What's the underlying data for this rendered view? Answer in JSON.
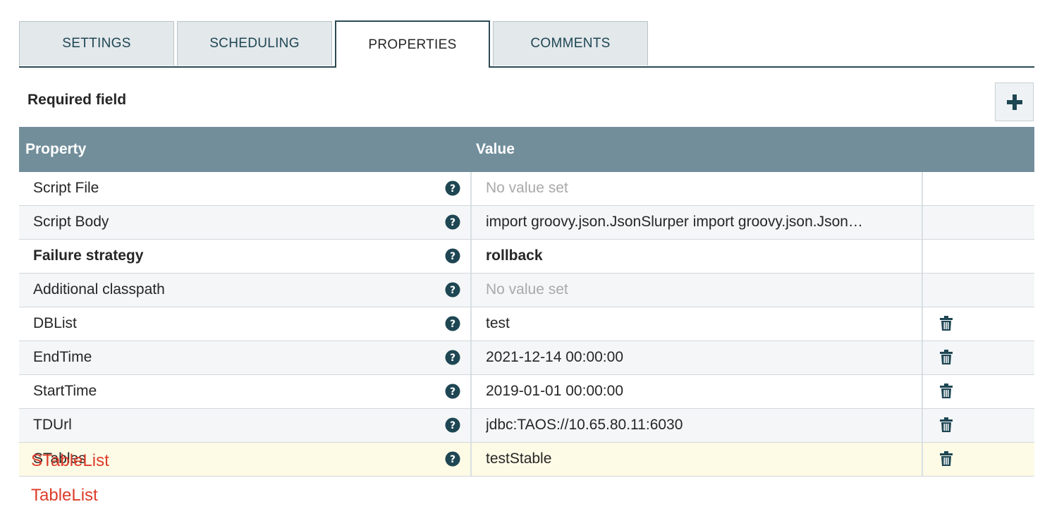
{
  "tabs": [
    {
      "label": "SETTINGS",
      "active": false
    },
    {
      "label": "SCHEDULING",
      "active": false
    },
    {
      "label": "PROPERTIES",
      "active": true
    },
    {
      "label": "COMMENTS",
      "active": false
    }
  ],
  "required_label": "Required field",
  "add_button_icon": "plus-icon",
  "table": {
    "headers": {
      "property": "Property",
      "value": "Value"
    },
    "rows": [
      {
        "name": "Script File",
        "value": "No value set",
        "empty": true,
        "bold": false,
        "deletable": false
      },
      {
        "name": "Script Body",
        "value": "import groovy.json.JsonSlurper import groovy.json.Json…",
        "empty": false,
        "bold": false,
        "deletable": false
      },
      {
        "name": "Failure strategy",
        "value": "rollback",
        "empty": false,
        "bold": true,
        "deletable": false
      },
      {
        "name": "Additional classpath",
        "value": "No value set",
        "empty": true,
        "bold": false,
        "deletable": false
      },
      {
        "name": "DBList",
        "value": "test",
        "empty": false,
        "bold": false,
        "deletable": true
      },
      {
        "name": "EndTime",
        "value": "2021-12-14 00:00:00",
        "empty": false,
        "bold": false,
        "deletable": true
      },
      {
        "name": "StartTime",
        "value": "2019-01-01 00:00:00",
        "empty": false,
        "bold": false,
        "deletable": true
      },
      {
        "name": "TDUrl",
        "value": "jdbc:TAOS://10.65.80.11:6030",
        "empty": false,
        "bold": false,
        "deletable": true
      },
      {
        "name": "STables",
        "value": "testStable",
        "empty": false,
        "bold": false,
        "deletable": true
      }
    ]
  },
  "missing_properties": [
    "STableList",
    "TableList"
  ],
  "colors": {
    "header_bg": "#728e9b",
    "tab_border": "#2b4a54",
    "icon": "#1e4653",
    "missing_text": "#dd3c2a",
    "highlight_row": "#fdfbe6"
  }
}
